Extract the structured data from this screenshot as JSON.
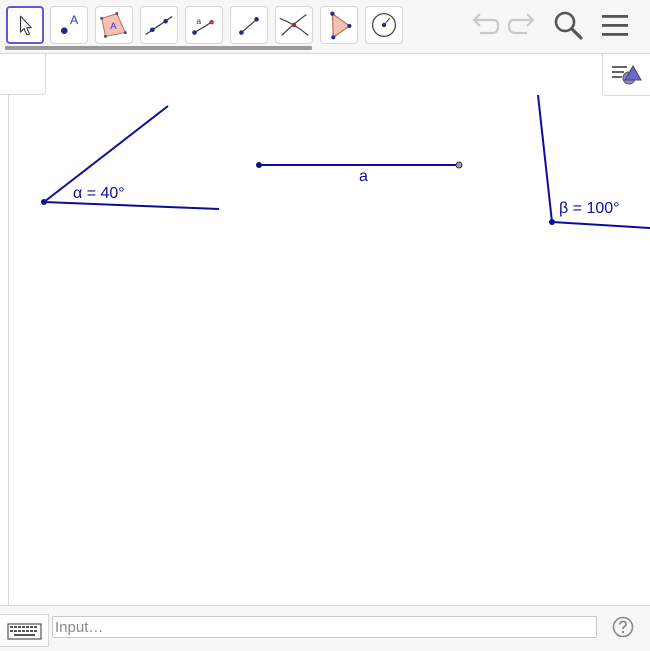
{
  "toolbar": {
    "tools": [
      {
        "name": "move-tool",
        "icon": "arrow-cursor-icon",
        "active": true
      },
      {
        "name": "point-tool",
        "icon": "point-icon",
        "label": "A"
      },
      {
        "name": "polygon-tool",
        "icon": "polygon-icon",
        "label": "A"
      },
      {
        "name": "line-tool",
        "icon": "line-icon"
      },
      {
        "name": "segment-fixed-length-tool",
        "icon": "segment-length-icon",
        "label": "a"
      },
      {
        "name": "segment-tool",
        "icon": "segment-icon"
      },
      {
        "name": "intersect-tool",
        "icon": "intersect-icon"
      },
      {
        "name": "triangle-tool",
        "icon": "triangle-icon"
      },
      {
        "name": "circle-tool",
        "icon": "circle-icon"
      }
    ],
    "right_icons": [
      "undo-icon",
      "redo-icon",
      "search-icon",
      "menu-icon"
    ]
  },
  "graphics": {
    "angle_alpha_label": "α = 40°",
    "segment_label": "a",
    "angle_beta_label": "β = 100°",
    "object_color": "#0d0d99"
  },
  "input_bar": {
    "placeholder": "Input…"
  },
  "colors": {
    "accent": "#6557d2",
    "polygon_fill": "#f2c2b4",
    "polygon_stroke": "#b66b5d"
  }
}
